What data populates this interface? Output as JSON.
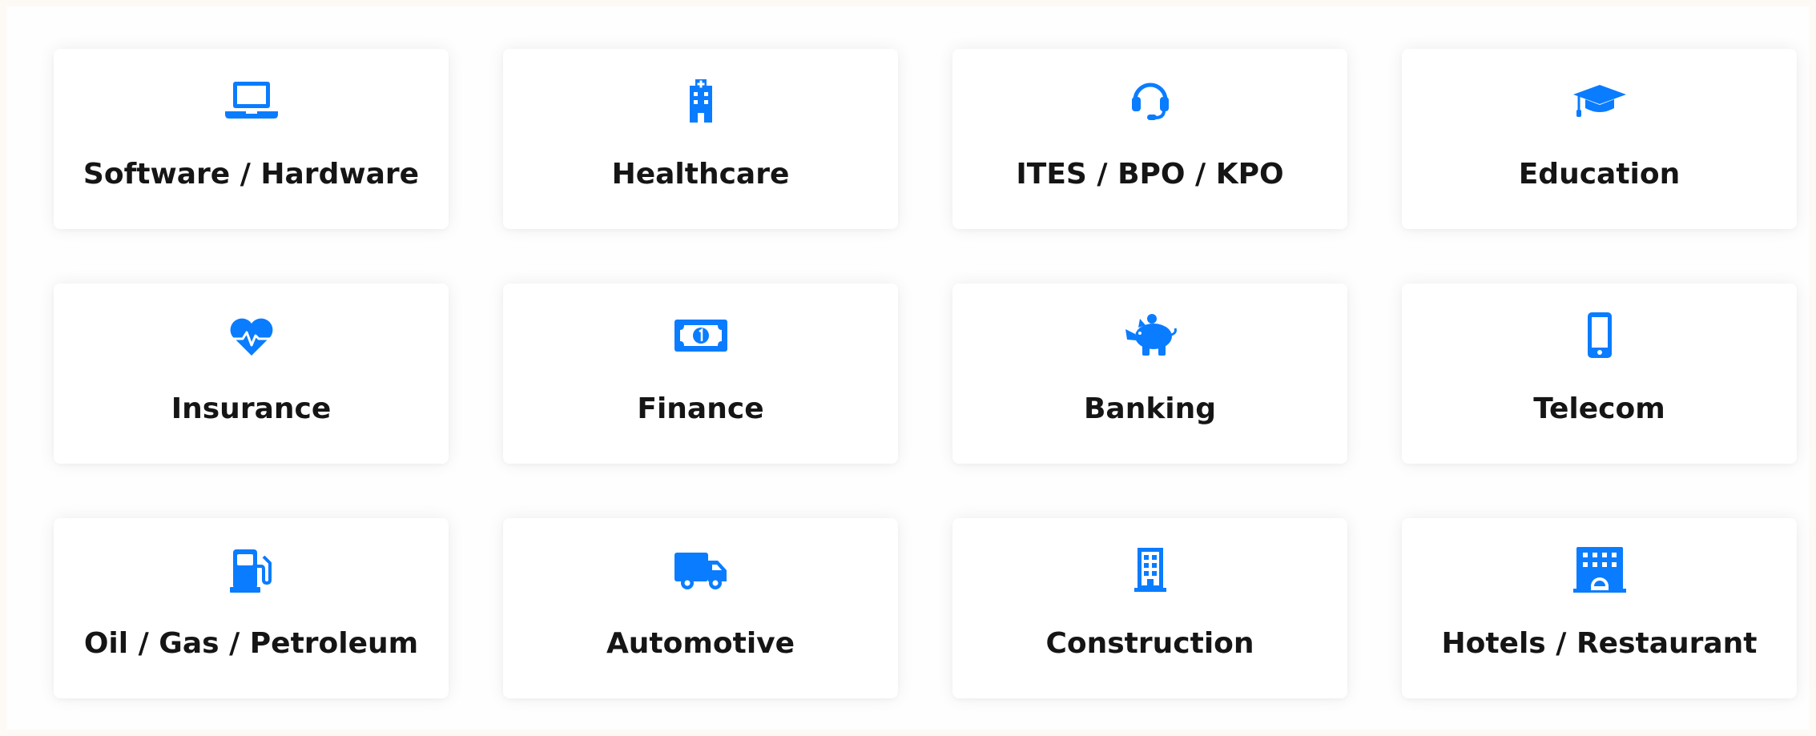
{
  "theme": {
    "accent": "#0a7cff",
    "text": "#151515",
    "card_background": "#ffffff",
    "page_background": "#fdf9f5"
  },
  "industries": [
    {
      "label": "Software / Hardware",
      "icon": "laptop-icon"
    },
    {
      "label": "Healthcare",
      "icon": "hospital-icon"
    },
    {
      "label": "ITES / BPO / KPO",
      "icon": "headset-icon"
    },
    {
      "label": "Education",
      "icon": "graduation-cap-icon"
    },
    {
      "label": "Insurance",
      "icon": "heartbeat-icon"
    },
    {
      "label": "Finance",
      "icon": "money-bill-icon"
    },
    {
      "label": "Banking",
      "icon": "piggy-bank-icon"
    },
    {
      "label": "Telecom",
      "icon": "mobile-phone-icon"
    },
    {
      "label": "Oil / Gas / Petroleum",
      "icon": "gas-pump-icon"
    },
    {
      "label": "Automotive",
      "icon": "truck-icon"
    },
    {
      "label": "Construction",
      "icon": "building-icon"
    },
    {
      "label": "Hotels / Restaurant",
      "icon": "hotel-icon"
    }
  ]
}
